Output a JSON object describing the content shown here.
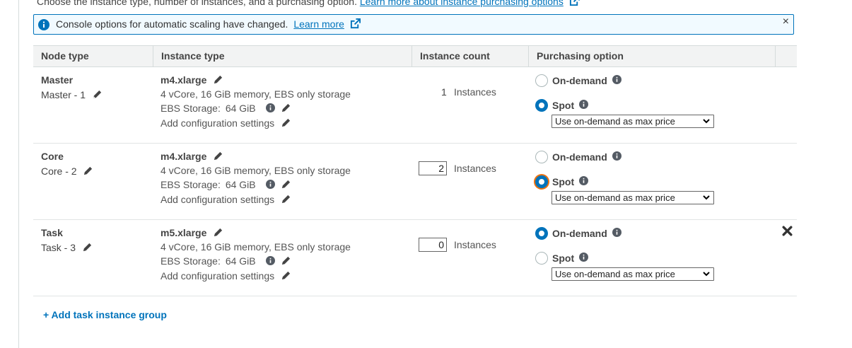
{
  "intro": {
    "text": "Choose the instance type, number of instances, and a purchasing option.",
    "link": "Learn more about instance purchasing options"
  },
  "banner": {
    "message": "Console options for automatic scaling have changed.",
    "link": "Learn more",
    "close": "×"
  },
  "table": {
    "headers": {
      "node_type": "Node type",
      "instance_type": "Instance type",
      "instance_count": "Instance count",
      "purchasing_option": "Purchasing option"
    },
    "rows": [
      {
        "node_type": "Master",
        "node_name": "Master - 1",
        "instance_type": "m4.xlarge",
        "spec": "4 vCore, 16 GiB memory, EBS only storage",
        "storage_label": "EBS Storage:",
        "storage_value": "64 GiB",
        "config": "Add configuration settings",
        "count": "1",
        "count_unit": "Instances",
        "on_demand_label": "On-demand",
        "spot_label": "Spot",
        "selected": "Spot",
        "max_price": "Use on-demand as max price"
      },
      {
        "node_type": "Core",
        "node_name": "Core - 2",
        "instance_type": "m4.xlarge",
        "spec": "4 vCore, 16 GiB memory, EBS only storage",
        "storage_label": "EBS Storage:",
        "storage_value": "64 GiB",
        "config": "Add configuration settings",
        "count": "2",
        "count_unit": "Instances",
        "on_demand_label": "On-demand",
        "spot_label": "Spot",
        "selected": "Spot",
        "max_price": "Use on-demand as max price"
      },
      {
        "node_type": "Task",
        "node_name": "Task - 3",
        "instance_type": "m5.xlarge",
        "spec": "4 vCore, 16 GiB memory, EBS only storage",
        "storage_label": "EBS Storage:",
        "storage_value": "64 GiB",
        "config": "Add configuration settings",
        "count": "0",
        "count_unit": "Instances",
        "on_demand_label": "On-demand",
        "spot_label": "Spot",
        "selected": "On-demand",
        "max_price": "Use on-demand as max price"
      }
    ]
  },
  "add_task_label": "+ Add task instance group",
  "colors": {
    "accent": "#0073bb",
    "focus_ring": "#ec7211",
    "banner_bg": "#f1faff",
    "header_bg": "#f2f3f3"
  },
  "icons": [
    "info-icon",
    "external-link-icon",
    "close-icon",
    "pencil-icon",
    "remove-icon",
    "chevron-down-icon"
  ]
}
